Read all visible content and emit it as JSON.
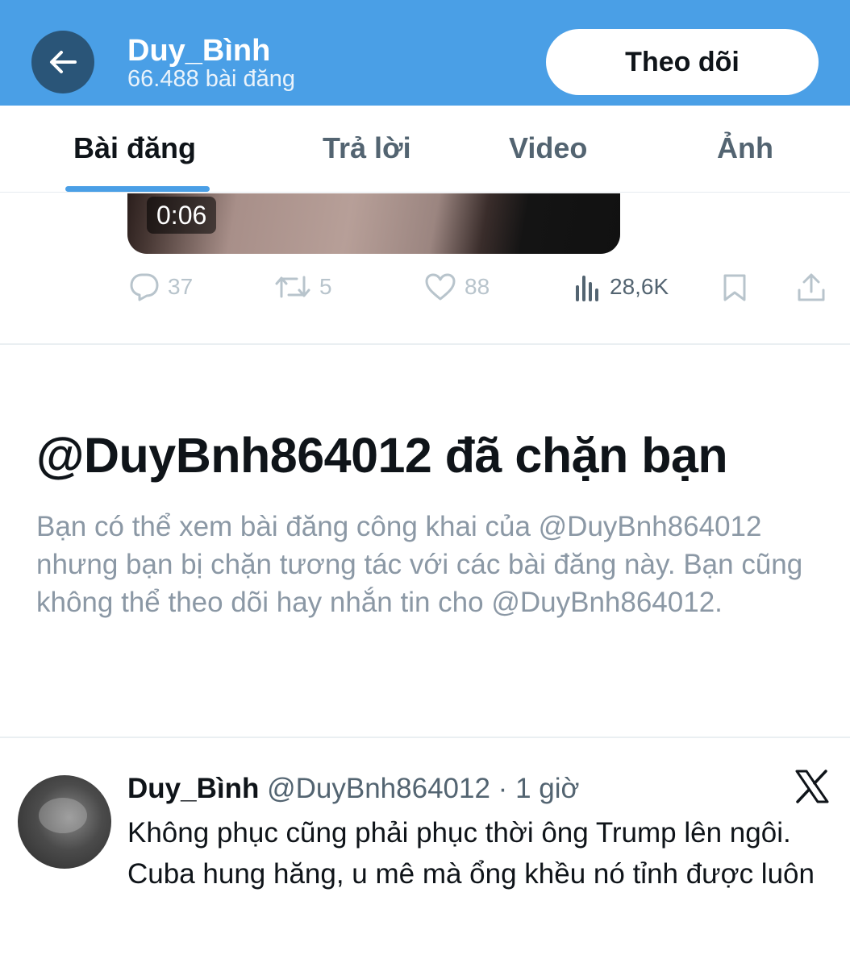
{
  "header": {
    "name": "Duy_Bình",
    "post_count": "66.488 bài đăng",
    "follow_label": "Theo dõi"
  },
  "tabs": [
    {
      "label": "Bài đăng",
      "active": true
    },
    {
      "label": "Trả lời",
      "active": false
    },
    {
      "label": "Video",
      "active": false
    },
    {
      "label": "Ảnh",
      "active": false
    }
  ],
  "video": {
    "duration": "0:06"
  },
  "actions": {
    "replies": "37",
    "reposts": "5",
    "likes": "88",
    "views": "28,6K"
  },
  "blocked": {
    "title": "@DuyBnh864012 đã chặn bạn",
    "description": "Bạn có thể xem bài đăng công khai của @DuyBnh864012 nhưng bạn bị chặn tương tác với các bài đăng này. Bạn cũng không thể theo dõi hay nhắn tin cho @DuyBnh864012."
  },
  "post": {
    "name": "Duy_Bình",
    "handle": "@DuyBnh864012",
    "separator": "·",
    "time": "1 giờ",
    "text": "Không phục cũng phải phục thời ông Trump lên ngôi. Cuba hung hăng, u mê mà ổng khều nó tỉnh được luôn"
  },
  "colors": {
    "header_bg": "#4a9fe6",
    "accent": "#4a9fe6",
    "back_button_bg": "#2a5578"
  }
}
